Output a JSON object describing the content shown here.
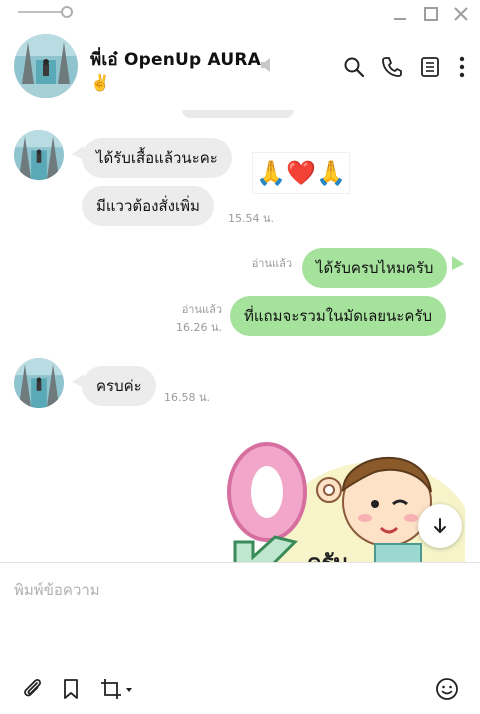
{
  "header": {
    "contact_name": "พี่เอ๋ OpenUp AURA",
    "name_emoji": "✌️"
  },
  "composer": {
    "placeholder": "พิมพ์ข้อความ"
  },
  "messages": [
    {
      "side": "in",
      "text": "ได้รับเสื้อแล้วนะคะ"
    },
    {
      "side": "in",
      "emoji": "🙏❤️🙏"
    },
    {
      "side": "in",
      "text": "มีแววต้องสั่งเพิ่ม",
      "time": "15.54 น."
    },
    {
      "side": "out",
      "text": "ได้รับครบไหมครับ",
      "read": "อ่านแล้ว"
    },
    {
      "side": "out",
      "text": "ที่แถมจะรวมในมัดเลยนะครับ",
      "read": "อ่านแล้ว",
      "time": "16.26 น."
    },
    {
      "side": "in",
      "text": "ครบค่ะ",
      "time": "16.58 น."
    },
    {
      "side": "in",
      "sticker": "ok-boy",
      "sticker_text": "ครับ"
    }
  ],
  "colors": {
    "incoming_bubble": "#ececec",
    "outgoing_bubble": "#a5e39d",
    "meta_text": "#9a9a9a"
  },
  "icons": [
    "search-icon",
    "phone-icon",
    "notes-icon",
    "more-icon",
    "mute-icon",
    "attach-icon",
    "bookmark-icon",
    "crop-icon",
    "emoji-icon",
    "arrow-down-icon"
  ]
}
